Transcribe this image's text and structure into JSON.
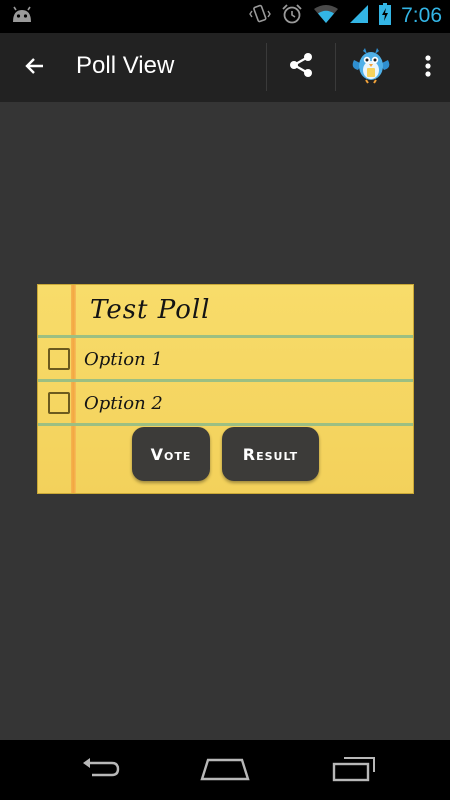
{
  "status_bar": {
    "time": "7:06",
    "icons": [
      "android-icon",
      "vibrate-icon",
      "alarm-icon",
      "wifi-icon",
      "signal-icon",
      "battery-charging-icon"
    ]
  },
  "action_bar": {
    "title": "Poll View",
    "icons": [
      "back-arrow-icon",
      "share-icon",
      "app-bird-icon",
      "overflow-menu-icon"
    ]
  },
  "poll": {
    "title": "Test Poll",
    "options": [
      {
        "label": "Option 1",
        "checked": false
      },
      {
        "label": "Option 2",
        "checked": false
      }
    ],
    "vote_label": "Vote",
    "result_label": "Result"
  },
  "nav_bar": {
    "icons": [
      "nav-back-icon",
      "nav-home-icon",
      "nav-recents-icon"
    ]
  },
  "colors": {
    "accent": "#33b5e5",
    "paper": "#f5d660",
    "button": "#3c3b39",
    "background": "#353535",
    "action_bar": "#222222"
  }
}
